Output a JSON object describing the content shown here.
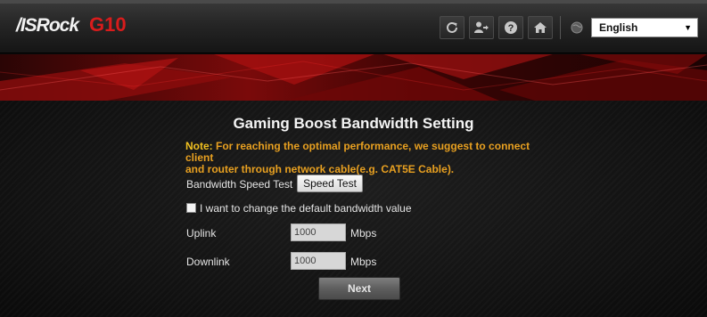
{
  "header": {
    "brand": "/ISRock",
    "model": "G10",
    "toolbar": {
      "icons": [
        "refresh-icon",
        "logout-icon",
        "help-icon",
        "home-icon"
      ],
      "globe_icon": "globe-icon"
    },
    "language": {
      "selected": "English",
      "caret": "▼"
    }
  },
  "main": {
    "title": "Gaming Boost Bandwidth Setting",
    "note_label": "Note:",
    "note_line1": " For reaching the optimal performance, we suggest to connect client",
    "note_line2": "and router through network cable(e.g. CAT5E Cable).",
    "speed_test_label": "Bandwidth Speed Test",
    "speed_test_button": "Speed Test",
    "change_default_label": "I want to change the default bandwidth value",
    "change_default_checked": false,
    "uplink_label": "Uplink",
    "uplink_value": "1000",
    "uplink_unit": "Mbps",
    "downlink_label": "Downlink",
    "downlink_value": "1000",
    "downlink_unit": "Mbps",
    "next_button": "Next"
  },
  "colors": {
    "brand_red": "#d81c1c",
    "note_orange": "#e8a020",
    "banner_red": "#9c0c0c"
  }
}
